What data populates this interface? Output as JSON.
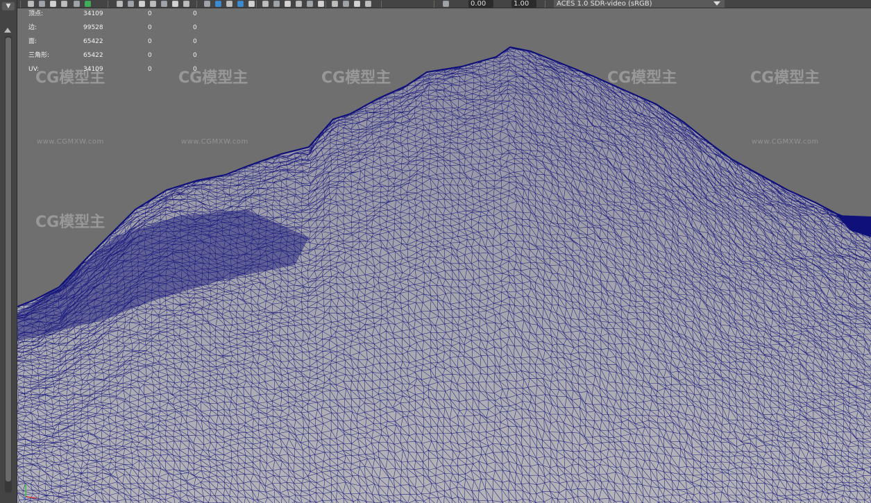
{
  "toolbar": {
    "exposure_value": "0.00",
    "gamma_value": "1.00",
    "color_space": "ACES 1.0 SDR-video (sRGB)",
    "icons": [
      "camera-icon",
      "camera-attr-icon",
      "bookmark-icon",
      "image-plane-icon",
      "2d-pan-icon",
      "grease-pencil-icon",
      "grid-icon",
      "film-gate-icon",
      "resolution-gate-icon",
      "gate-mask-icon",
      "field-chart-icon",
      "safe-action-icon",
      "safe-title-icon",
      "wireframe-icon",
      "smooth-shade-icon",
      "use-default-material-icon",
      "wireframe-on-shaded-icon",
      "xray-icon",
      "default-lighting-icon",
      "shadows-icon",
      "screen-space-ao-icon",
      "motion-blur-icon",
      "anti-aliasing-icon",
      "depth-of-field-icon",
      "isolate-select-icon",
      "xray-joints-icon",
      "xray-active-icon",
      "backface-culling-icon",
      "exposure-icon",
      "gamma-icon",
      "color-management-icon"
    ]
  },
  "hud": {
    "rows": [
      {
        "label": "顶点:",
        "v1": "34109",
        "v2": "0",
        "v3": "0"
      },
      {
        "label": "边:",
        "v1": "99528",
        "v2": "0",
        "v3": "0"
      },
      {
        "label": "面:",
        "v1": "65422",
        "v2": "0",
        "v3": "0"
      },
      {
        "label": "三角形:",
        "v1": "65422",
        "v2": "0",
        "v3": "0"
      },
      {
        "label": "UV:",
        "v1": "34109",
        "v2": "0",
        "v3": "0"
      }
    ]
  },
  "watermark": {
    "logo_text": "CG模型主",
    "url_text": "www.CGMXW.com"
  },
  "colors": {
    "viewport_bg": "#6f6f6f",
    "mesh_fill": "#a5a5ab",
    "wire": "#10107a",
    "toolbar_bg": "#444444",
    "accent_blue": "#3a8bd0"
  }
}
